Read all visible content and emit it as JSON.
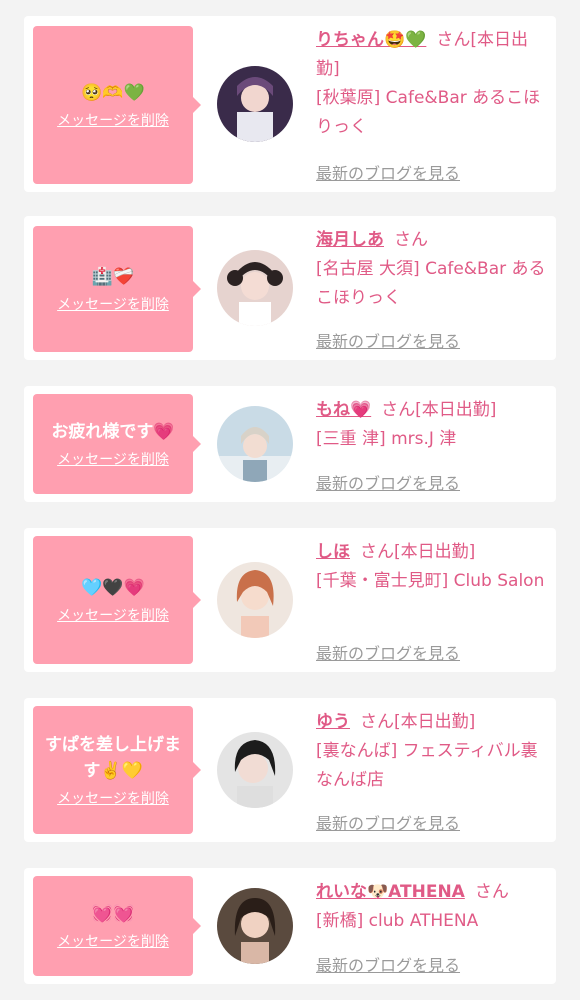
{
  "delete_label": "メッセージを削除",
  "blog_label": "最新のブログを見る",
  "san_label": "さん",
  "cards": [
    {
      "message": "🥺🫶💚",
      "name": "りちゃん🤩💚",
      "san_suffix": "[本日出勤]",
      "location": "[秋葉原] Cafe&Bar あるこほりっく"
    },
    {
      "message": "🏥❤️‍🩹",
      "name": "海月しあ",
      "san_suffix": "",
      "location": "[名古屋 大須] Cafe&Bar あるこほりっく"
    },
    {
      "message": "お疲れ様です💗",
      "name": "もね💗",
      "san_suffix": "[本日出勤]",
      "location": "[三重 津] mrs.J 津"
    },
    {
      "message": "🩵🖤💗",
      "name": "しほ",
      "san_suffix": "[本日出勤]",
      "location": "[千葉・富士見町] Club Salon"
    },
    {
      "message": "すぱを差し上げます✌️💛",
      "name": "ゆう",
      "san_suffix": "[本日出勤]",
      "location": "[裏なんば] フェスティバル裏なんば店"
    },
    {
      "message": "💓💓",
      "name": "れいな🐶ATHENA",
      "san_suffix": "",
      "location": "[新橋] club ATHENA"
    }
  ],
  "colors": {
    "bubble": "#ff9fb0",
    "name": "#e05a86",
    "link": "#9a9a9a",
    "background": "#f3f3f3"
  }
}
